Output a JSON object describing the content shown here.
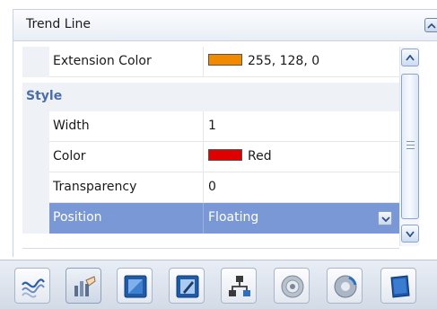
{
  "panel": {
    "title": "Trend Line",
    "collapse_icon": "chevron-up-icon"
  },
  "grid": {
    "rows_before": [
      {
        "name": "Extension Color",
        "value": "255, 128, 0",
        "swatch": "#f28a00"
      }
    ],
    "category": "Style",
    "rows": [
      {
        "name": "Width",
        "value": "1"
      },
      {
        "name": "Color",
        "value": "Red",
        "swatch": "#e00000"
      },
      {
        "name": "Transparency",
        "value": "0"
      },
      {
        "name": "Position",
        "value": "Floating",
        "selected": true
      }
    ]
  },
  "colors": {
    "selection": "#7b98d6",
    "category_text": "#4a6eaa",
    "gutter": "#eef1f6"
  },
  "toolbar": {
    "tools": [
      {
        "icon": "trend-waves-icon"
      },
      {
        "icon": "bar-chart-hand-icon",
        "active": true
      },
      {
        "icon": "window-blue-icon"
      },
      {
        "icon": "edit-window-icon"
      },
      {
        "icon": "network-icon"
      },
      {
        "icon": "gear-disc-icon"
      },
      {
        "icon": "refresh-disc-icon"
      },
      {
        "icon": "blue-book-icon"
      }
    ]
  }
}
